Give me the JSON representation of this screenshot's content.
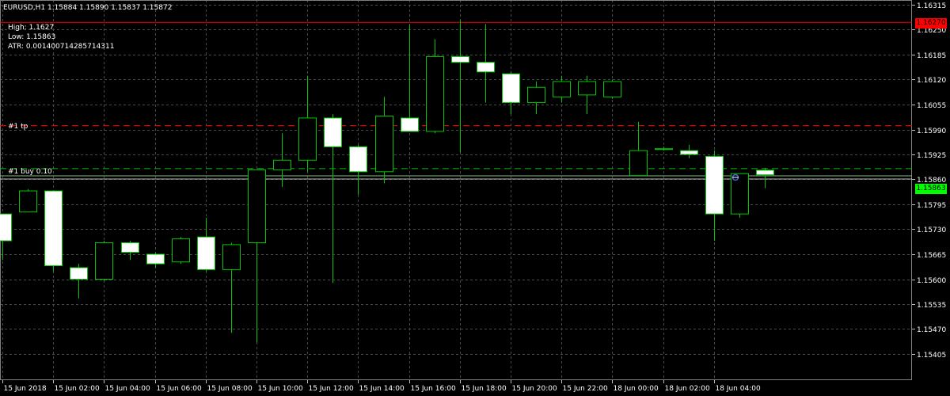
{
  "header": {
    "symbol_line": "EURUSD,H1  1.15884 1.15890 1.15837 1.15872",
    "high_line": "High: 1.1627",
    "low_line": "Low: 1.15863",
    "atr_line": "ATR: 0.001400714285714311"
  },
  "order_tags": {
    "tp_label": "#1 tp",
    "buy_label": "#1 buy 0.10"
  },
  "price_boxes": {
    "high_value": "1.16270",
    "current_value": "1.15863"
  },
  "colors": {
    "background": "#000000",
    "grid": "#4a4a4a",
    "candle_up_fill": "#000000",
    "candle_down_fill": "#ffffff",
    "candle_outline": "#00c800",
    "high_line": "#ff0000",
    "tp_line": "#ff0000",
    "buy_line": "#00c800",
    "bid_line": "#c0c0c0",
    "high_box": "#ff0000",
    "current_box": "#00ff00"
  },
  "chart_data": {
    "type": "candlestick",
    "symbol": "EURUSD",
    "timeframe": "H1",
    "y_ticks": [
      "1.16315",
      "1.16250",
      "1.16185",
      "1.16120",
      "1.16055",
      "1.15990",
      "1.15925",
      "1.15860",
      "1.15795",
      "1.15730",
      "1.15665",
      "1.15600",
      "1.15535",
      "1.15470",
      "1.15405"
    ],
    "ylim": [
      1.15405,
      1.16315
    ],
    "x_ticks": [
      "15 Jun 2018",
      "15 Jun 02:00",
      "15 Jun 04:00",
      "15 Jun 06:00",
      "15 Jun 08:00",
      "15 Jun 10:00",
      "15 Jun 12:00",
      "15 Jun 14:00",
      "15 Jun 16:00",
      "15 Jun 18:00",
      "15 Jun 20:00",
      "15 Jun 22:00",
      "18 Jun 00:00",
      "18 Jun 02:00",
      "18 Jun 04:00"
    ],
    "levels": {
      "high": 1.1627,
      "tp": 1.16,
      "buy": 1.15888,
      "bid": 1.15863
    },
    "candles": [
      {
        "o": 1.1577,
        "h": 1.1577,
        "l": 1.1565,
        "c": 1.157
      },
      {
        "o": 1.15775,
        "h": 1.15835,
        "l": 1.15775,
        "c": 1.1583
      },
      {
        "o": 1.1583,
        "h": 1.1583,
        "l": 1.1562,
        "c": 1.15635
      },
      {
        "o": 1.1563,
        "h": 1.1564,
        "l": 1.1555,
        "c": 1.156
      },
      {
        "o": 1.156,
        "h": 1.157,
        "l": 1.15595,
        "c": 1.15695
      },
      {
        "o": 1.15695,
        "h": 1.157,
        "l": 1.1565,
        "c": 1.1567
      },
      {
        "o": 1.15665,
        "h": 1.1567,
        "l": 1.1563,
        "c": 1.1564
      },
      {
        "o": 1.15645,
        "h": 1.1571,
        "l": 1.1564,
        "c": 1.15705
      },
      {
        "o": 1.1571,
        "h": 1.1576,
        "l": 1.1562,
        "c": 1.15625
      },
      {
        "o": 1.15625,
        "h": 1.15695,
        "l": 1.1546,
        "c": 1.1569
      },
      {
        "o": 1.15695,
        "h": 1.15885,
        "l": 1.15435,
        "c": 1.15885
      },
      {
        "o": 1.15885,
        "h": 1.1598,
        "l": 1.1584,
        "c": 1.1591
      },
      {
        "o": 1.1591,
        "h": 1.1613,
        "l": 1.1588,
        "c": 1.1602
      },
      {
        "o": 1.1602,
        "h": 1.1603,
        "l": 1.1559,
        "c": 1.15945
      },
      {
        "o": 1.15945,
        "h": 1.1595,
        "l": 1.1582,
        "c": 1.1588
      },
      {
        "o": 1.1588,
        "h": 1.16075,
        "l": 1.1585,
        "c": 1.16025
      },
      {
        "o": 1.1602,
        "h": 1.16265,
        "l": 1.1599,
        "c": 1.15985
      },
      {
        "o": 1.15985,
        "h": 1.16225,
        "l": 1.1598,
        "c": 1.1618
      },
      {
        "o": 1.1618,
        "h": 1.16275,
        "l": 1.1593,
        "c": 1.16165
      },
      {
        "o": 1.16165,
        "h": 1.16265,
        "l": 1.1606,
        "c": 1.1614
      },
      {
        "o": 1.16135,
        "h": 1.1614,
        "l": 1.1603,
        "c": 1.1606
      },
      {
        "o": 1.1606,
        "h": 1.16115,
        "l": 1.1603,
        "c": 1.161
      },
      {
        "o": 1.16075,
        "h": 1.1613,
        "l": 1.1606,
        "c": 1.16115
      },
      {
        "o": 1.1608,
        "h": 1.1613,
        "l": 1.1603,
        "c": 1.16115
      },
      {
        "o": 1.16075,
        "h": 1.1612,
        "l": 1.1607,
        "c": 1.16115
      },
      {
        "o": 1.1587,
        "h": 1.1601,
        "l": 1.1587,
        "c": 1.15935
      },
      {
        "o": 1.1594,
        "h": 1.15945,
        "l": 1.15935,
        "c": 1.1594
      },
      {
        "o": 1.15935,
        "h": 1.1595,
        "l": 1.15915,
        "c": 1.15925
      },
      {
        "o": 1.1592,
        "h": 1.15935,
        "l": 1.157,
        "c": 1.1577
      },
      {
        "o": 1.1577,
        "h": 1.1587,
        "l": 1.1576,
        "c": 1.15875
      },
      {
        "o": 1.15884,
        "h": 1.1589,
        "l": 1.15837,
        "c": 1.15872
      }
    ]
  }
}
